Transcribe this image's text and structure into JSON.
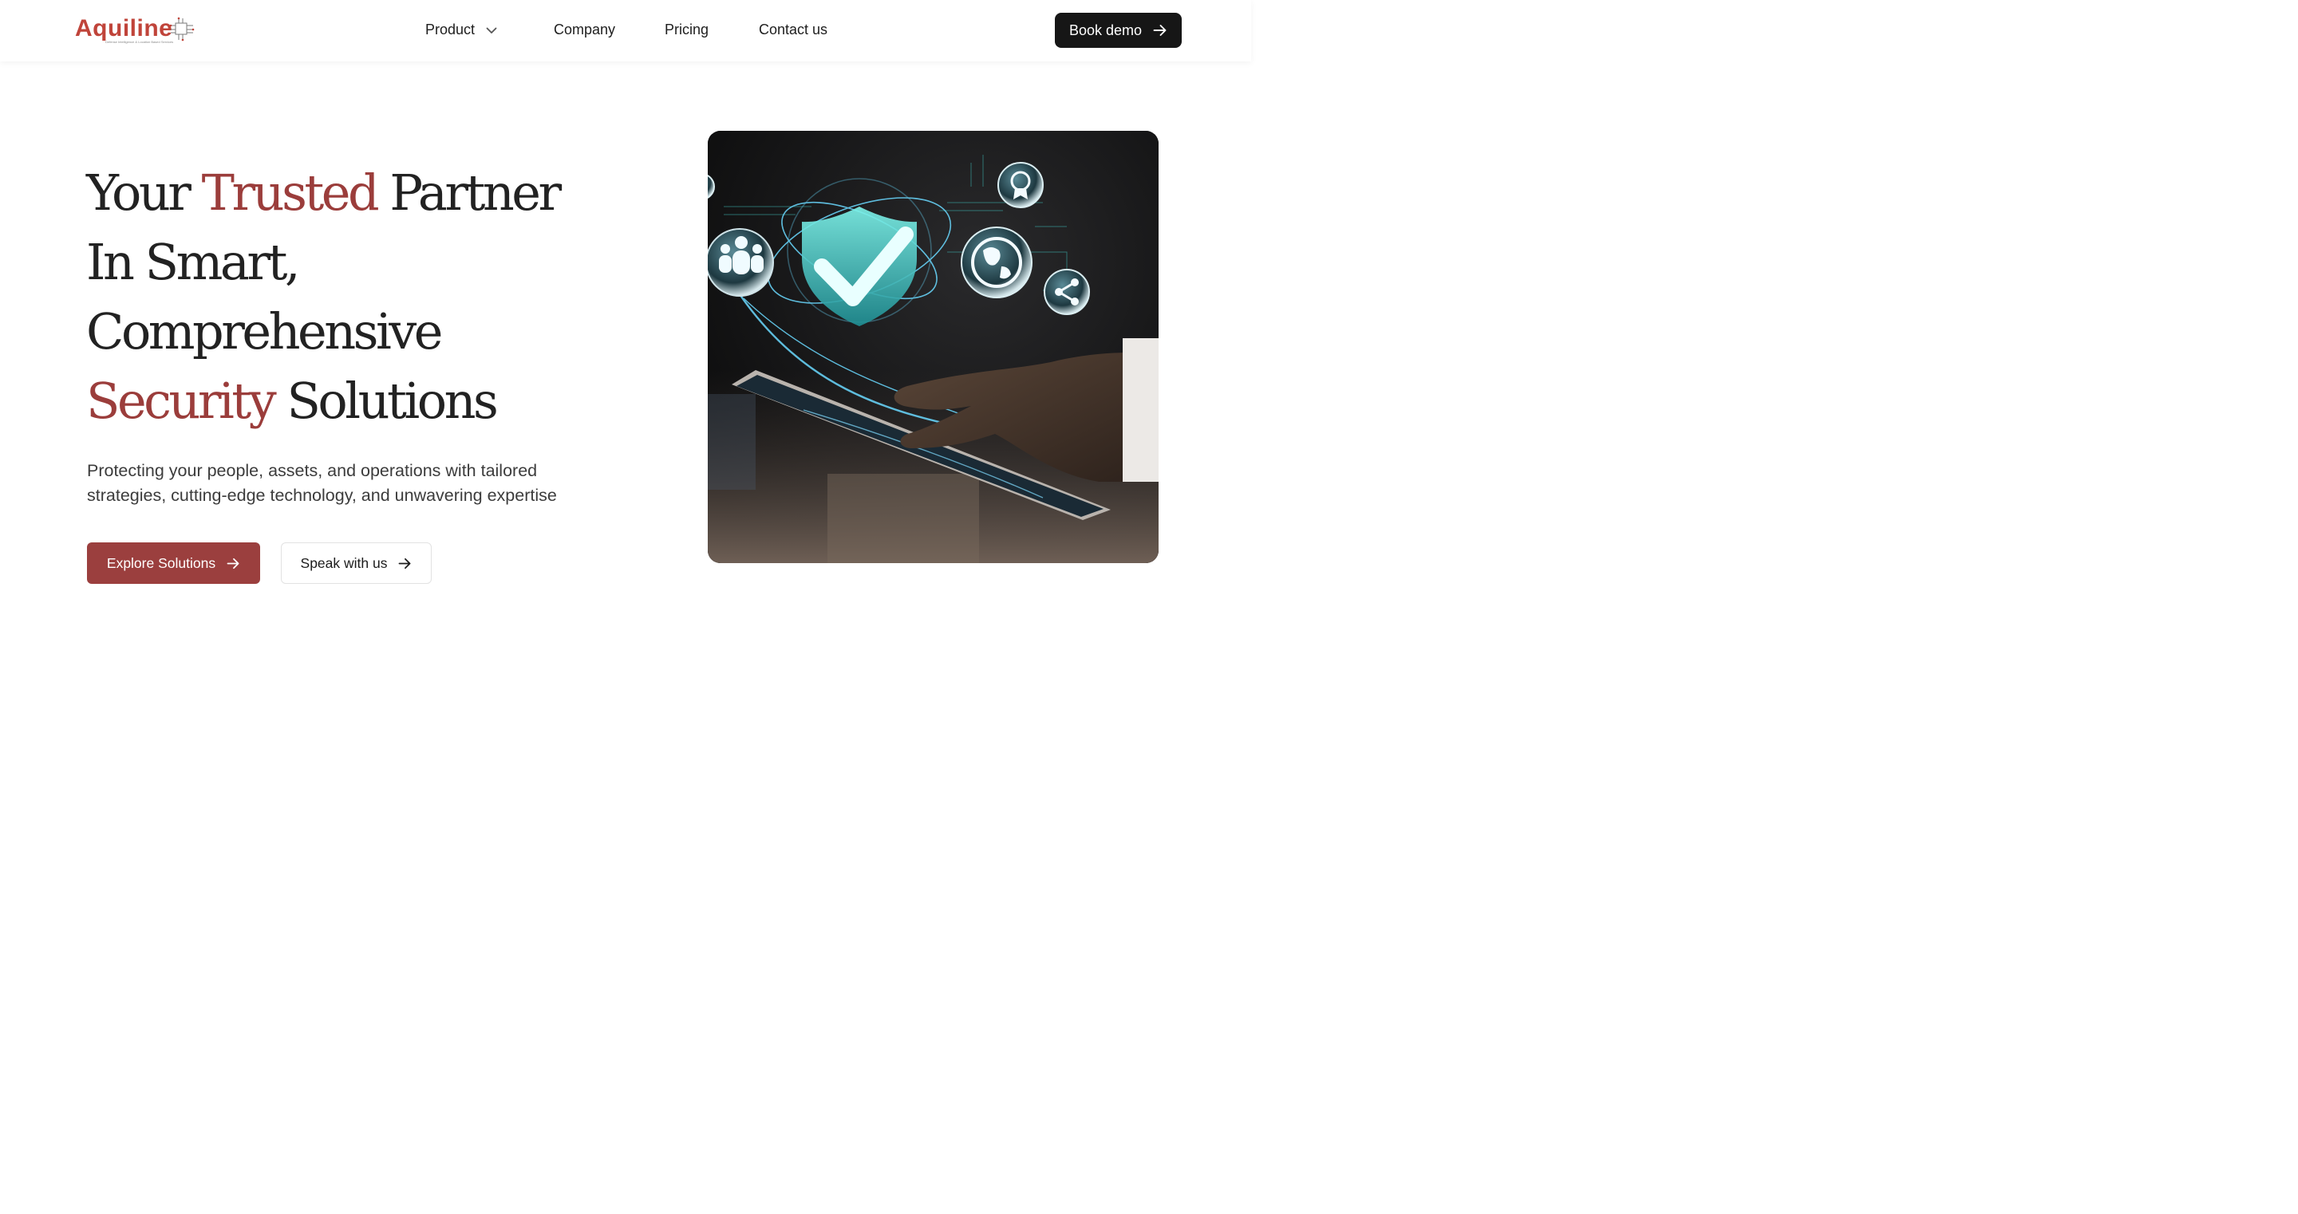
{
  "brand": {
    "name": "Aquiline",
    "tagline": "Defense Intelligence & Location Based Services"
  },
  "nav": {
    "items": [
      {
        "label": "Product",
        "has_dropdown": true
      },
      {
        "label": "Company"
      },
      {
        "label": "Pricing"
      },
      {
        "label": "Contact us"
      }
    ],
    "cta": "Book demo"
  },
  "hero": {
    "headline": {
      "w1": "Your",
      "w2": "Trusted",
      "w3": "Partner",
      "line2": "In Smart,",
      "line3": "Comprehensive",
      "w4": "Security",
      "w5": "Solutions"
    },
    "subtitle": "Protecting your people, assets, and operations with tailored strategies, cutting-edge technology, and unwavering expertise",
    "primary_button": "Explore Solutions",
    "secondary_button": "Speak with us"
  },
  "colors": {
    "accent": "#9b3d3b",
    "logo": "#c0443a",
    "dark": "#161616",
    "glow": "#5fe3e0"
  },
  "icons": [
    "chevron-down-icon",
    "arrow-right-icon",
    "shield-check-icon",
    "people-icon",
    "globe-icon",
    "share-icon",
    "award-icon"
  ]
}
